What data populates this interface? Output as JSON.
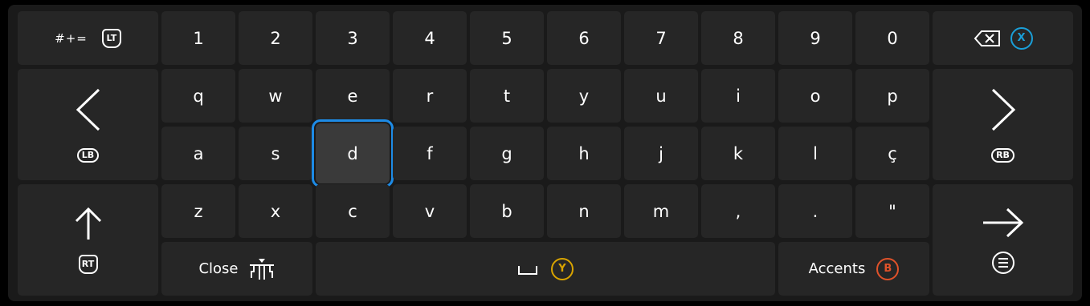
{
  "symbols_key": {
    "label": "#+=",
    "hint": "LT"
  },
  "backspace_key": {
    "hint": "X"
  },
  "numbers": [
    "1",
    "2",
    "3",
    "4",
    "5",
    "6",
    "7",
    "8",
    "9",
    "0"
  ],
  "row_q": [
    "q",
    "w",
    "e",
    "r",
    "t",
    "y",
    "u",
    "i",
    "o",
    "p"
  ],
  "row_a": [
    "a",
    "s",
    "d",
    "f",
    "g",
    "h",
    "j",
    "k",
    "l",
    "ç"
  ],
  "row_z": [
    "z",
    "x",
    "c",
    "v",
    "b",
    "n",
    "m",
    ",",
    ".",
    "\""
  ],
  "left_key": {
    "hint": "LB"
  },
  "right_key": {
    "hint": "RB"
  },
  "shift_key": {
    "hint": "RT"
  },
  "close_key": {
    "label": "Close"
  },
  "space_key": {
    "hint": "Y"
  },
  "accents_key": {
    "label": "Accents",
    "hint": "B"
  },
  "selected_key": "d",
  "colors": {
    "focus": "#1d8be6",
    "x_button": "#1a9fd8",
    "y_button": "#d9a400",
    "b_button": "#e0522a"
  }
}
